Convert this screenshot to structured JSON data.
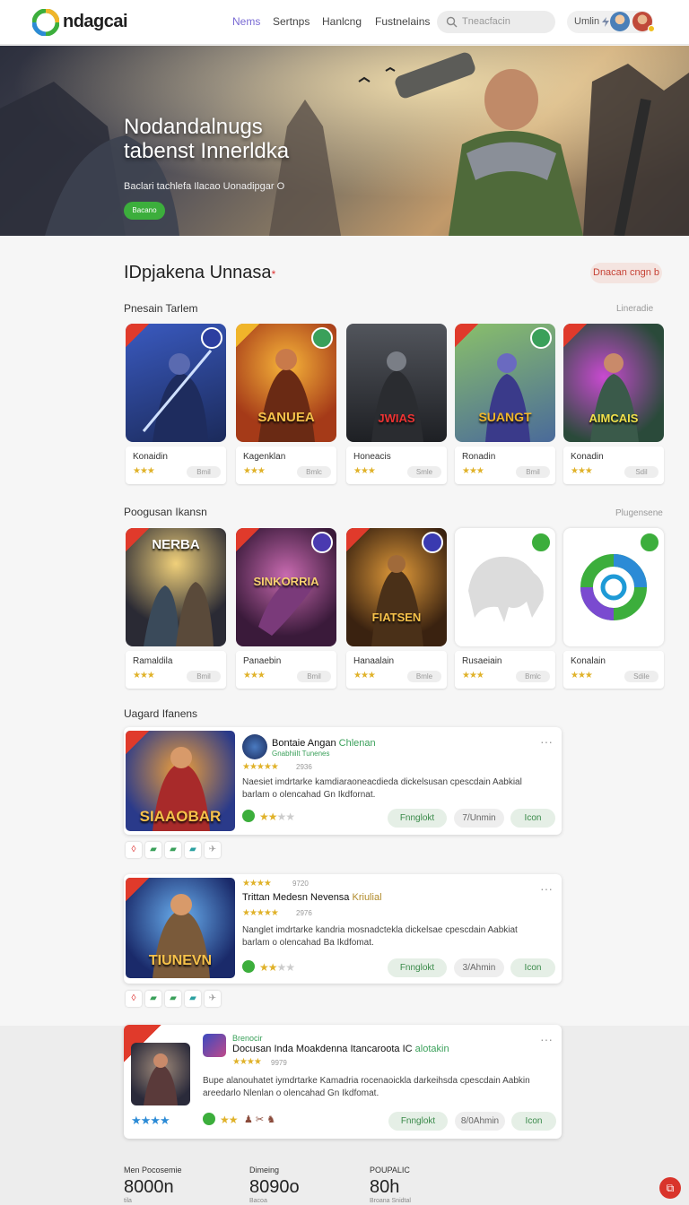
{
  "header": {
    "brand": "ndagcai",
    "nav": [
      "Nems",
      "Sertnps",
      "Hanlcng",
      "Fustnelains"
    ],
    "search_placeholder": "Tneacfacin",
    "user_label": "Umlin"
  },
  "hero": {
    "title_line1": "Nodandalnugs",
    "title_line2": "tabenst Innerldka",
    "subtitle": "Baclari tachlefa Ilacao  Uonadipgar O",
    "button_label": "Bacano"
  },
  "section": {
    "title": "IDpjakena Unnasa",
    "title_mark": "*",
    "action_label": "Dnacan cngn b"
  },
  "rows": [
    {
      "label": "Pnesain Tarlem",
      "more": "Lineradie",
      "cards": [
        {
          "name": "Konaidin",
          "stars": "★★★",
          "ver": "Bmil",
          "art": "",
          "accent": "#2b3e8a"
        },
        {
          "name": "Kagenklan",
          "stars": "★★★",
          "ver": "Bmlc",
          "art": "SANUEA",
          "accent": "#c0532a"
        },
        {
          "name": "Honeacis",
          "stars": "★★★",
          "ver": "Smle",
          "art": "JWIAS",
          "accent": "#3b3f45"
        },
        {
          "name": "Ronadin",
          "stars": "★★★",
          "ver": "Bmil",
          "art": "SUANGT",
          "accent": "#5a7a3a"
        },
        {
          "name": "Konadin",
          "stars": "★★★",
          "ver": "Sdil",
          "art": "AIMCAIS",
          "accent": "#6b3a7a"
        }
      ]
    },
    {
      "label": "Poogusan Ikansn",
      "more": "Plugensene",
      "cards": [
        {
          "name": "Ramaldila",
          "stars": "★★★",
          "ver": "Bmil",
          "art": "NERBA",
          "accent": "#3a3a44"
        },
        {
          "name": "Panaebin",
          "stars": "★★★",
          "ver": "Bmil",
          "art": "SINKORRIA",
          "accent": "#6a2e5a"
        },
        {
          "name": "Hanaalain",
          "stars": "★★★",
          "ver": "Bmle",
          "art": "FIATSEN",
          "accent": "#5a3a22"
        },
        {
          "name": "Rusaeiain",
          "stars": "★★★",
          "ver": "Bmlc",
          "art": "",
          "accent": "#e8e8e8"
        },
        {
          "name": "Konalain",
          "stars": "★★★",
          "ver": "Sdile",
          "art": "",
          "accent": "#f3f3f3"
        }
      ]
    }
  ],
  "featured_label": "Uagard Ifanens",
  "featured": [
    {
      "art": "SIAAOBAR",
      "title": "Bontaie Angan",
      "title_green": "Chlenan",
      "sub": "Gnabhiilt Tunenes",
      "stars": "★★★★★",
      "count": "2936",
      "desc_line1": "Naesiet imdrtarke kamdiaraoneacdieda dickelsusan cpescdain Aabkial",
      "desc_line2": "barlam o olencahad Gn Ikdfornat.",
      "rating": "★★",
      "rating_empty": "★★",
      "btn1": "Fnnglokt",
      "btn2": "7/Unmin",
      "btn3": "Icon"
    },
    {
      "art": "TIUNEVN",
      "pre_stars": "★★★★",
      "pre_count": "9720",
      "title": "Trittan Medesn Nevensa",
      "title_green": "Kriulial",
      "stars": "★★★★★",
      "count": "2976",
      "desc_line1": "Nanglet imdrtarke kandria mosnadctekla dickelsae cpescdain Aabkiat",
      "desc_line2": "barlam o olencahad Ba Ikdfomat.",
      "rating": "★★",
      "rating_empty": "★★",
      "btn1": "Fnnglokt",
      "btn2": "3/Ahmin",
      "btn3": "Icon"
    },
    {
      "art": "",
      "pre": "Brenocir",
      "title": "Docusan Inda Moakdenna Itancaroota IC",
      "title_green": "alotakin",
      "stars": "★★★★",
      "count": "9979",
      "desc_line1": "Bupe alanouhatet iymdrtarke Kamadria rocenaoickla darkeihsda cpescdain Aabkin",
      "desc_line2": "areedarlo Nlenlan o olencahad Gn Ikdfomat.",
      "left_stars": "★★★★",
      "rating": "★★",
      "btn1": "Fnnglokt",
      "btn2": "8/0Ahmin",
      "btn3": "Icon"
    }
  ],
  "stats": [
    {
      "label": "Men Pocosemie",
      "value": "8000n",
      "note": "tila"
    },
    {
      "label": "Dimeing",
      "value": "8090o",
      "note": "Bacoa"
    },
    {
      "label": "POUPALIC",
      "value": "80h",
      "note": "Broana Snidtal"
    }
  ],
  "colors": {
    "accent": "#3cae3c",
    "brand_green": "#3aa05a",
    "star": "#e0b22a",
    "red": "#d33"
  }
}
